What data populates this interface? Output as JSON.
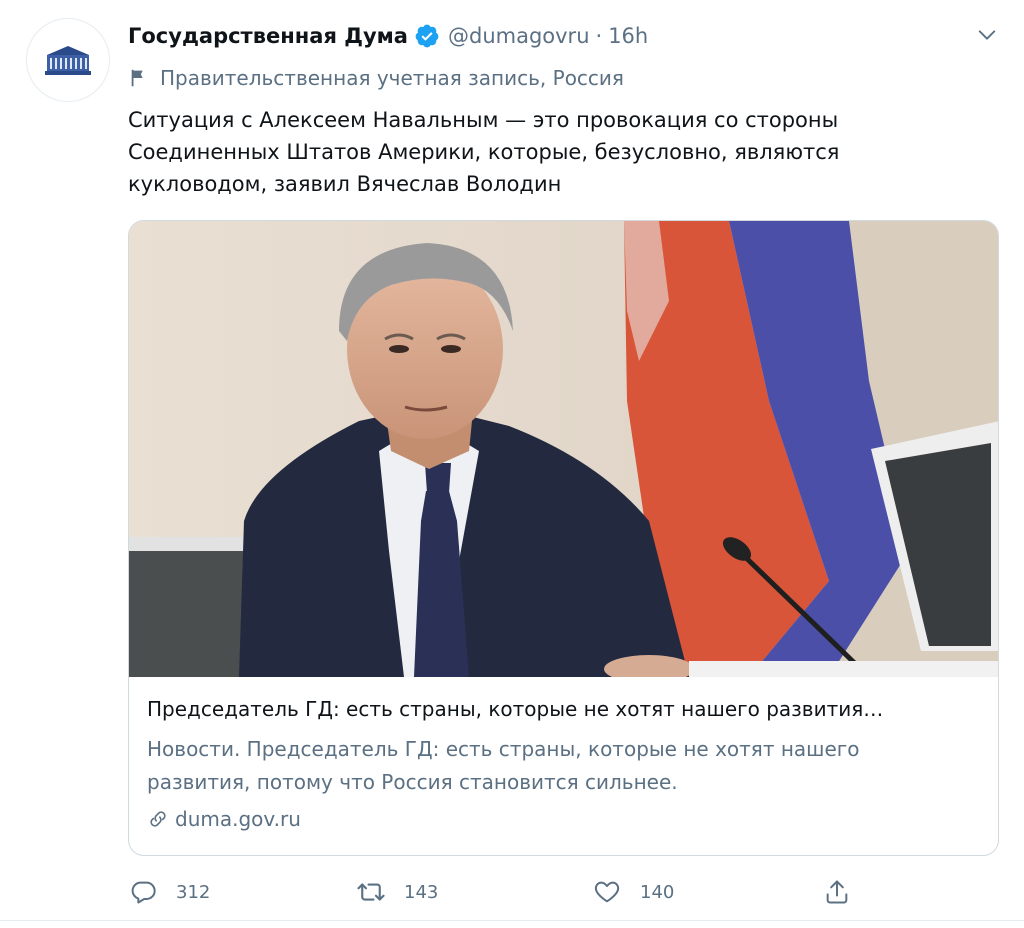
{
  "account": {
    "display_name": "Государственная Дума",
    "handle": "@dumagovru",
    "separator": "·",
    "time": "16h",
    "label": "Правительственная учетная запись, Россия"
  },
  "tweet": {
    "lines": [
      "Ситуация с Алексеем Навальным — это провокация со стороны",
      "Соединенных Штатов Америки, которые, безусловно, являются",
      "кукловодом, заявил Вячеслав Володин"
    ]
  },
  "card": {
    "title": "Председатель ГД: есть страны, которые не хотят нашего развития…",
    "description_lines": [
      "Новости. Председатель ГД: есть страны, которые не хотят нашего",
      "развития, потому что Россия становится сильнее."
    ],
    "domain": "duma.gov.ru"
  },
  "actions": {
    "replies": "312",
    "retweets": "143",
    "likes": "140"
  },
  "icons": {
    "verified": "verified-badge-icon",
    "caret": "chevron-down-icon",
    "label": "flag-icon",
    "link": "link-icon",
    "reply": "reply-icon",
    "retweet": "retweet-icon",
    "like": "heart-icon",
    "share": "share-icon"
  },
  "colors": {
    "verified_blue": "#1da1f2",
    "secondary_text": "#5b7083",
    "border": "#cfd9de"
  }
}
